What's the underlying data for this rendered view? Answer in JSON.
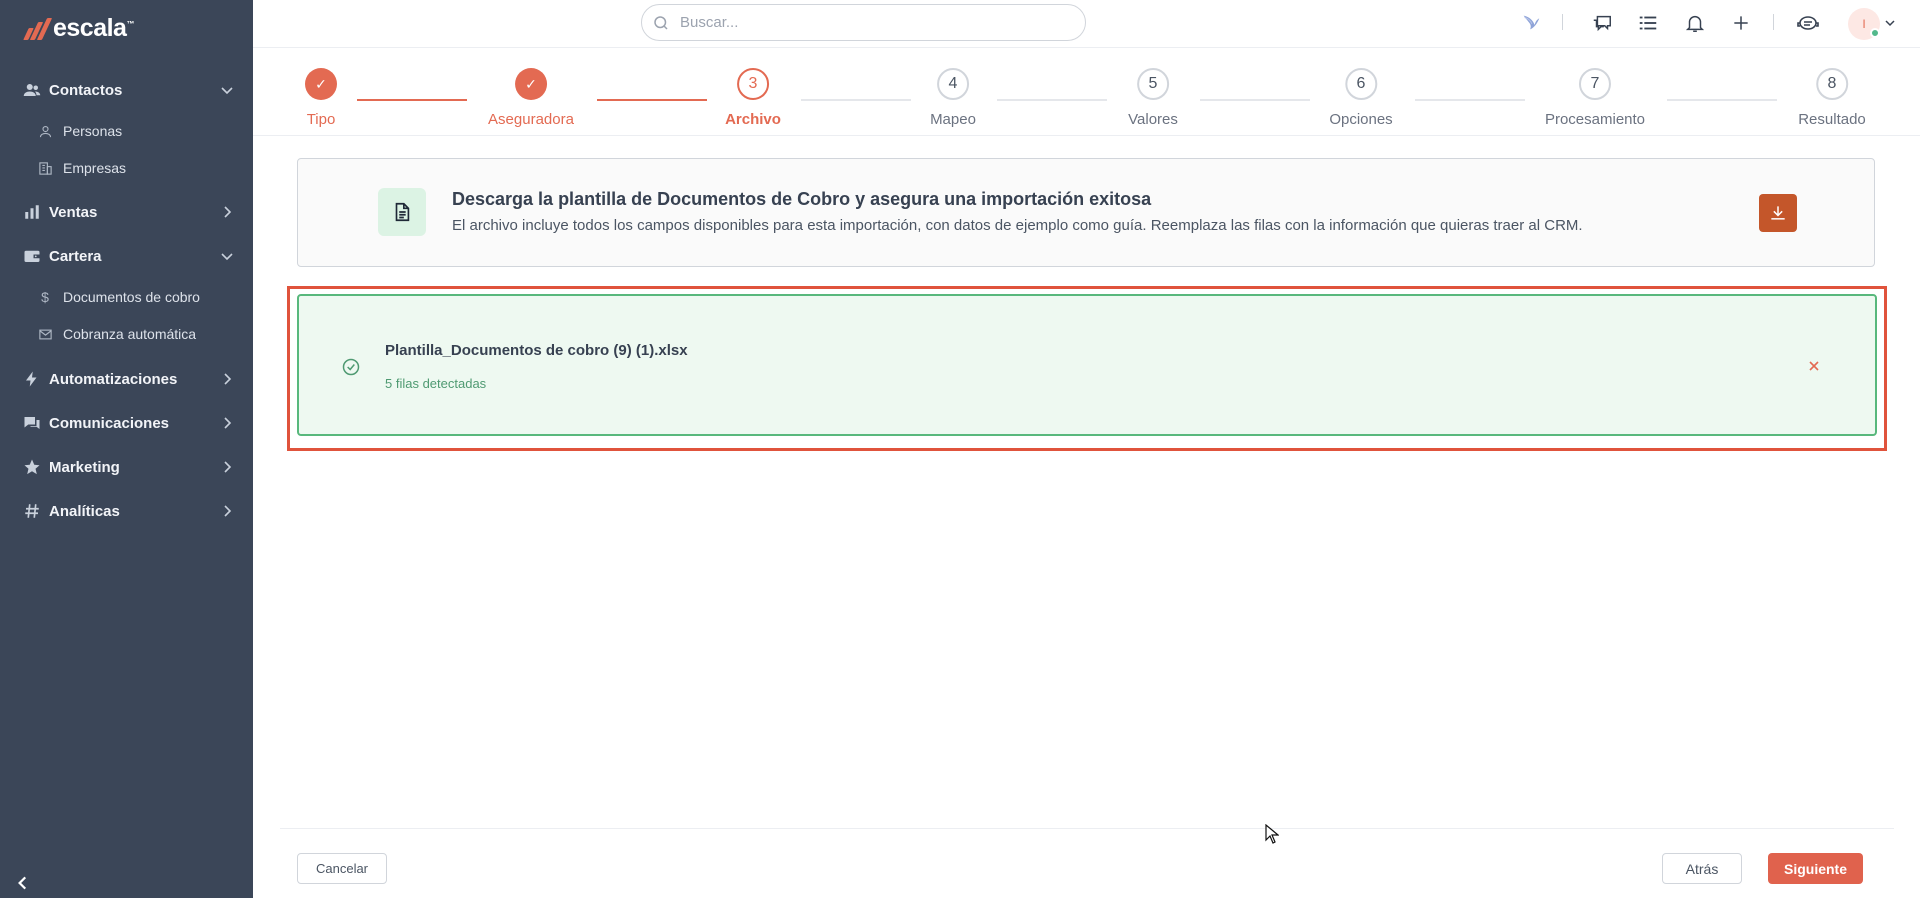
{
  "app": {
    "brand": "escala",
    "brand_tm": "™"
  },
  "sidebar": {
    "sections": [
      {
        "label": "Contactos",
        "icon": "users-icon",
        "expanded": true
      },
      {
        "label": "Ventas",
        "icon": "chart-icon",
        "expanded": false
      },
      {
        "label": "Cartera",
        "icon": "wallet-icon",
        "expanded": true
      },
      {
        "label": "Automatizaciones",
        "icon": "bolt-icon",
        "expanded": false
      },
      {
        "label": "Comunicaciones",
        "icon": "chat-icon",
        "expanded": false
      },
      {
        "label": "Marketing",
        "icon": "star-icon",
        "expanded": false
      },
      {
        "label": "Analíticas",
        "icon": "hash-icon",
        "expanded": false
      }
    ],
    "subitems": [
      {
        "label": "Personas",
        "icon": "person-icon"
      },
      {
        "label": "Empresas",
        "icon": "building-icon"
      },
      {
        "label": "Documentos de cobro",
        "icon": "dollar-icon"
      },
      {
        "label": "Cobranza automática",
        "icon": "mail-icon"
      }
    ]
  },
  "topbar": {
    "search_placeholder": "Buscar...",
    "avatar_initial": "I"
  },
  "stepper": {
    "steps": [
      {
        "number": "✓",
        "label": "Tipo",
        "state": "done"
      },
      {
        "number": "✓",
        "label": "Aseguradora",
        "state": "done"
      },
      {
        "number": "3",
        "label": "Archivo",
        "state": "active"
      },
      {
        "number": "4",
        "label": "Mapeo",
        "state": "pending"
      },
      {
        "number": "5",
        "label": "Valores",
        "state": "pending"
      },
      {
        "number": "6",
        "label": "Opciones",
        "state": "pending"
      },
      {
        "number": "7",
        "label": "Procesamiento",
        "state": "pending"
      },
      {
        "number": "8",
        "label": "Resultado",
        "state": "pending"
      }
    ]
  },
  "download_card": {
    "title": "Descarga la plantilla de Documentos de Cobro y asegura una importación exitosa",
    "description": "El archivo incluye todos los campos disponibles para esta importación, con datos de ejemplo como guía. Reemplaza las filas con la información que quieras traer al CRM."
  },
  "file_card": {
    "file_name": "Plantilla_Documentos de cobro (9) (1).xlsx",
    "rows_detected": "5 filas detectadas"
  },
  "footer": {
    "cancel_label": "Cancelar",
    "back_label": "Atrás",
    "next_label": "Siguiente"
  },
  "colors": {
    "accent": "#e36a52",
    "sidebar_bg": "#3b4658",
    "success": "#58b87c",
    "download_btn": "#c4562a",
    "highlight_border": "#e0533c"
  }
}
